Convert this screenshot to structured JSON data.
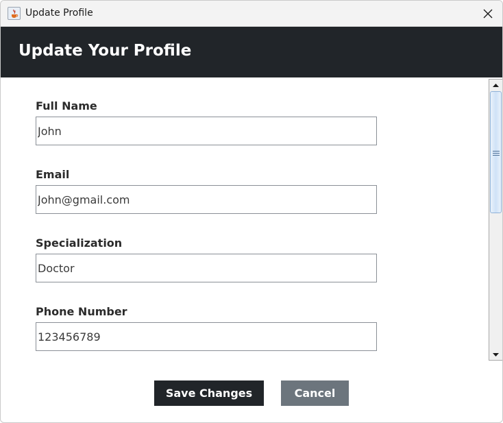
{
  "window": {
    "title": "Update Profile"
  },
  "header": {
    "title": "Update Your Profile"
  },
  "form": {
    "full_name": {
      "label": "Full Name",
      "value": "John"
    },
    "email": {
      "label": "Email",
      "value": "John@gmail.com"
    },
    "specialization": {
      "label": "Specialization",
      "value": "Doctor"
    },
    "phone": {
      "label": "Phone Number",
      "value": "123456789"
    }
  },
  "actions": {
    "save_label": "Save Changes",
    "cancel_label": "Cancel"
  },
  "colors": {
    "header_bg": "#212529",
    "save_bg": "#212529",
    "cancel_bg": "#6c757d"
  },
  "icons": {
    "app": "java-app-icon",
    "close": "close-icon",
    "scroll_up": "arrow-up-icon",
    "scroll_down": "arrow-down-icon"
  }
}
